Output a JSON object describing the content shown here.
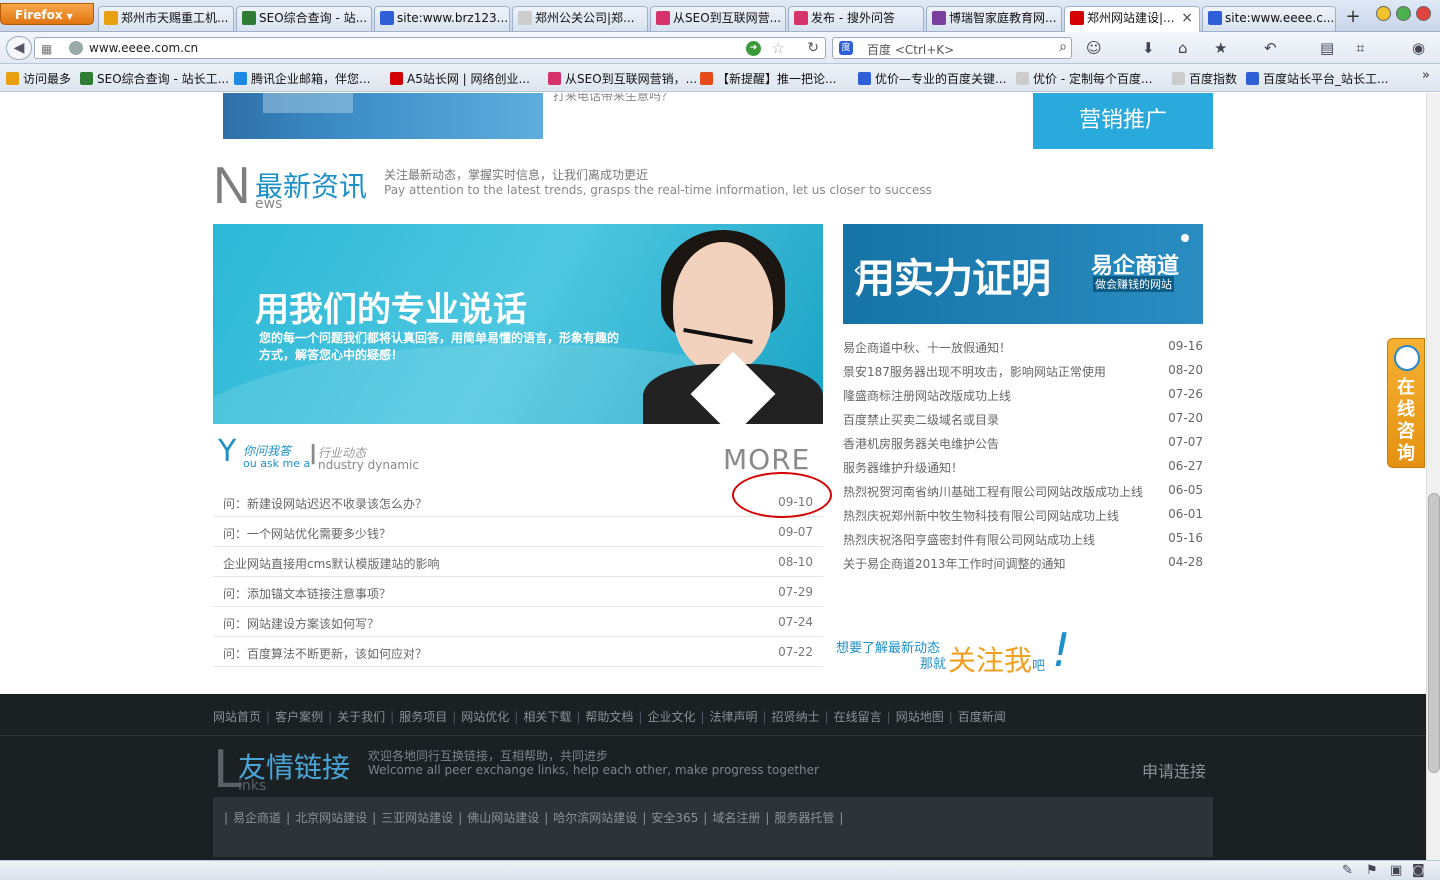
{
  "browser": {
    "menu_label": "Firefox",
    "tabs": [
      {
        "label": "郑州市天赐重工机...",
        "icon_color": "#e8a010"
      },
      {
        "label": "SEO综合查询 - 站...",
        "icon_color": "#2e7d32"
      },
      {
        "label": "site:www.brz123....",
        "icon_color": "#2e5fd6"
      },
      {
        "label": "郑州公关公司|郑...",
        "icon_color": "#cccccc"
      },
      {
        "label": "从SEO到互联网营...",
        "icon_color": "#d6336c"
      },
      {
        "label": "发布 - 搜外问答",
        "icon_color": "#d6336c"
      },
      {
        "label": "博瑞智家庭教育网...",
        "icon_color": "#7b3fa0"
      },
      {
        "label": "郑州网站建设|...",
        "icon_color": "#d40000"
      },
      {
        "label": "site:www.eeee.c...",
        "icon_color": "#2e5fd6"
      }
    ],
    "active_tab_index": 7,
    "new_tab_label": "+",
    "url": "www.eeee.com.cn",
    "search_placeholder": "百度 <Ctrl+K>",
    "bookmarks": [
      {
        "label": "访问最多",
        "icon_color": "#e8a010"
      },
      {
        "label": "SEO综合查询 - 站长工...",
        "icon_color": "#2e7d32"
      },
      {
        "label": "腾讯企业邮箱，伴您...",
        "icon_color": "#1e88e5"
      },
      {
        "label": "A5站长网 | 网络创业...",
        "icon_color": "#d40000"
      },
      {
        "label": "从SEO到互联网营销，...",
        "icon_color": "#d6336c"
      },
      {
        "label": "【新提醒】推一把论...",
        "icon_color": "#e64a19"
      },
      {
        "label": "优价—专业的百度关键...",
        "icon_color": "#2e5fd6"
      },
      {
        "label": "优价 - 定制每个百度...",
        "icon_color": "#cccccc"
      },
      {
        "label": "百度指数",
        "icon_color": "#cccccc"
      },
      {
        "label": "百度站长平台_站长工...",
        "icon_color": "#2e5fd6"
      }
    ],
    "bookmarks_more": "»"
  },
  "page": {
    "top_snippet": "打来电话带来生意吗？",
    "marketing_button": "营销推广",
    "news_section": {
      "big_letter": "N",
      "title_cn": "最新资讯",
      "title_en_rest": "ews",
      "subtitle_cn": "关注最新动态，掌握实时信息，让我们离成功更近",
      "subtitle_en": "Pay attention to the latest trends, grasps the real-time information, let us closer to success"
    },
    "support_banner": {
      "title": "用我们的专业说话",
      "description": "您的每一个问题我们都将认真回答，用简单易懂的语言，形象有趣的方式，解答您心中的疑感！"
    },
    "qa_section": {
      "tab1_letter": "Y",
      "tab1_cn": "你问我答",
      "tab1_en": "ou ask me a",
      "tab2_letter": "I",
      "tab2_cn": "行业动态",
      "tab2_en": "ndustry dynamic",
      "more": "MORE",
      "items": [
        {
          "title": "问：新建设网站迟迟不收录该怎么办？",
          "date": "09-10"
        },
        {
          "title": "问：一个网站优化需要多少钱？",
          "date": "09-07"
        },
        {
          "title": "企业网站直接用cms默认模版建站的影响",
          "date": "08-10"
        },
        {
          "title": "问：添加锚文本链接注意事项？",
          "date": "07-29"
        },
        {
          "title": "问：网站建设方案该如何写？",
          "date": "07-24"
        },
        {
          "title": "问：百度算法不断更新，该如何应对？",
          "date": "07-22"
        }
      ]
    },
    "proof_banner": {
      "main": "用实力证明",
      "brand": "易企商道",
      "slogan": "做会赚钱的网站"
    },
    "news_items": [
      {
        "title": "易企商道中秋、十一放假通知！",
        "date": "09-16"
      },
      {
        "title": "景安187服务器出现不明攻击，影响网站正常使用",
        "date": "08-20"
      },
      {
        "title": "隆盛商标注册网站改版成功上线",
        "date": "07-26"
      },
      {
        "title": "百度禁止买卖二级域名或目录",
        "date": "07-20"
      },
      {
        "title": "香港机房服务器关电维护公告",
        "date": "07-07"
      },
      {
        "title": "服务器维护升级通知！",
        "date": "06-27"
      },
      {
        "title": "热烈祝贺河南省纳川基础工程有限公司网站改版成功上线",
        "date": "06-05"
      },
      {
        "title": "热烈庆祝郑州新中牧生物科技有限公司网站成功上线",
        "date": "06-01"
      },
      {
        "title": "热烈庆祝洛阳亨盛密封件有限公司网站成功上线",
        "date": "05-16"
      },
      {
        "title": "关于易企商道2013年工作时间调整的通知",
        "date": "04-28"
      }
    ],
    "follow": {
      "line1": "想要了解最新动态",
      "line2": "那就",
      "big": "关注我",
      "suffix": "吧",
      "excl": "!"
    },
    "float_service": "在线咨询",
    "footer": {
      "nav_links": [
        "网站首页",
        "客户案例",
        "关于我们",
        "服务项目",
        "网站优化",
        "相关下载",
        "帮助文档",
        "企业文化",
        "法律声明",
        "招贤纳士",
        "在线留言",
        "网站地图",
        "百度新闻"
      ],
      "links_big_letter": "L",
      "links_title_cn": "友情链接",
      "links_title_en_rest": "inks",
      "links_sub_cn": "欢迎各地同行互换链接，互相帮助，共同进步",
      "links_sub_en": "Welcome all peer exchange links, help each other, make progress together",
      "apply": "申请连接",
      "friend_links": [
        "易企商道",
        "北京网站建设",
        "三亚网站建设",
        "佛山网站建设",
        "哈尔滨网站建设",
        "安全365",
        "域名注册",
        "服务器托管"
      ]
    }
  }
}
